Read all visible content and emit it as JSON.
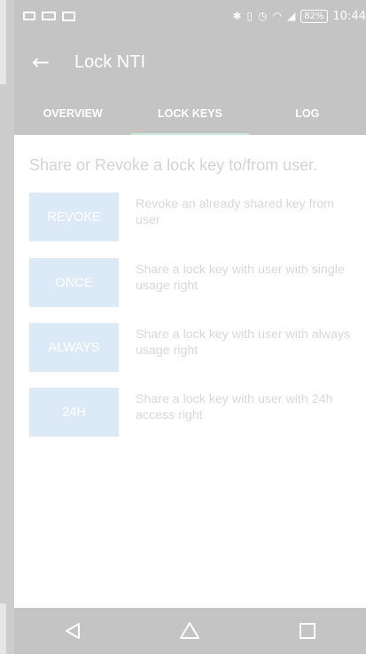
{
  "status_bar": {
    "time": "10:44",
    "battery": "82%",
    "icons": [
      "image-icon",
      "cast-icon",
      "mail-icon",
      "bluetooth-icon",
      "vibrate-icon",
      "alarm-icon",
      "wifi-icon",
      "signal-icon",
      "battery-icon"
    ]
  },
  "app_bar": {
    "title": "Lock NTI",
    "back_icon": "arrow-left-icon"
  },
  "tabs": [
    {
      "label": "OVERVIEW",
      "active": false
    },
    {
      "label": "LOCK KEYS",
      "active": true
    },
    {
      "label": "LOG",
      "active": false
    }
  ],
  "main": {
    "heading": "Share or Revoke a lock key to/from user.",
    "actions": [
      {
        "button": "REVOKE",
        "description": "Revoke an already shared key from user"
      },
      {
        "button": "ONCE",
        "description": "Share a lock key with user with single usage right"
      },
      {
        "button": "ALWAYS",
        "description": "Share a lock key with user with always usage right"
      },
      {
        "button": "24H",
        "description": "Share a lock key with user with 24h access right"
      }
    ]
  },
  "nav_bar": {
    "icons": [
      "back-triangle-icon",
      "home-icon",
      "recents-icon"
    ]
  },
  "colors": {
    "bar": "#c4c4c4",
    "button": "#dce9f6",
    "tab_indicator": "#c8ead6",
    "disabled_text": "#d8d8d8"
  }
}
